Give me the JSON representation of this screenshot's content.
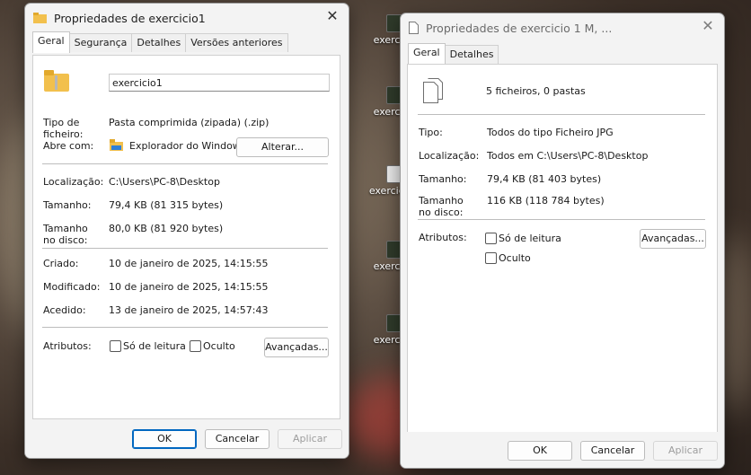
{
  "desktop": {
    "icons": [
      {
        "label": "exercicio"
      },
      {
        "label": "exercicio"
      },
      {
        "label": "exercicio L"
      },
      {
        "label": "exercicio"
      },
      {
        "label": "exercicio"
      }
    ]
  },
  "window1": {
    "title": "Propriedades de exercicio1",
    "tabs": [
      "Geral",
      "Segurança",
      "Detalhes",
      "Versões anteriores"
    ],
    "filename": "exercicio1",
    "type_label": "Tipo de ficheiro:",
    "type_value": "Pasta comprimida (zipada) (.zip)",
    "opens_label": "Abre com:",
    "opens_value": "Explorador do Windows",
    "change_button": "Alterar...",
    "location_label": "Localização:",
    "location_value": "C:\\Users\\PC-8\\Desktop",
    "size_label": "Tamanho:",
    "size_value": "79,4 KB (81 315 bytes)",
    "disk_label": "Tamanho no disco:",
    "disk_value": "80,0 KB (81 920 bytes)",
    "created_label": "Criado:",
    "created_value": "10 de janeiro de 2025, 14:15:55",
    "modified_label": "Modificado:",
    "modified_value": "10 de janeiro de 2025, 14:15:55",
    "accessed_label": "Acedido:",
    "accessed_value": "13 de janeiro de 2025, 14:57:43",
    "attributes_label": "Atributos:",
    "readonly_label": "Só de leitura",
    "hidden_label": "Oculto",
    "advanced_button": "Avançadas...",
    "ok_button": "OK",
    "cancel_button": "Cancelar",
    "apply_button": "Aplicar"
  },
  "window2": {
    "title": "Propriedades de exercicio 1 M, ...",
    "tabs": [
      "Geral",
      "Detalhes"
    ],
    "summary": "5 ficheiros, 0 pastas",
    "type_label": "Tipo:",
    "type_value": "Todos do tipo Ficheiro JPG",
    "location_label": "Localização:",
    "location_value": "Todos em C:\\Users\\PC-8\\Desktop",
    "size_label": "Tamanho:",
    "size_value": "79,4 KB (81 403 bytes)",
    "disk_label": "Tamanho no disco:",
    "disk_value": "116 KB (118 784 bytes)",
    "attributes_label": "Atributos:",
    "readonly_label": "Só de leitura",
    "hidden_label": "Oculto",
    "advanced_button": "Avançadas...",
    "ok_button": "OK",
    "cancel_button": "Cancelar",
    "apply_button": "Aplicar"
  }
}
